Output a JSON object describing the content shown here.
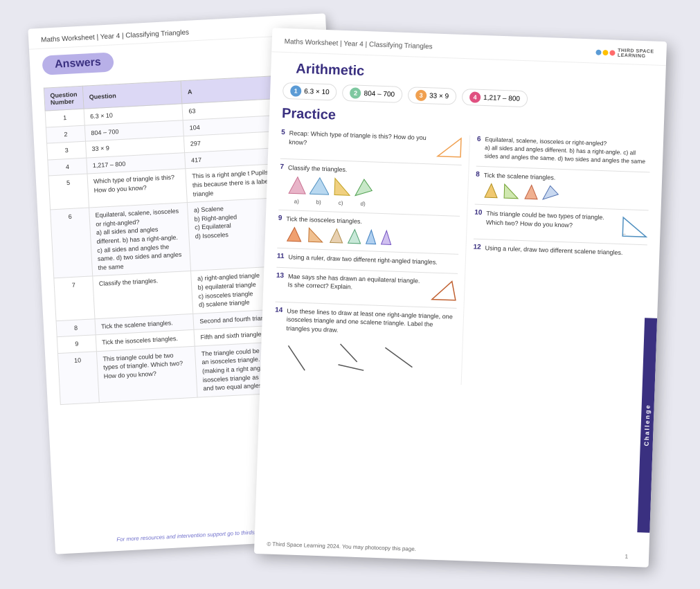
{
  "answers_page": {
    "header": "Maths Worksheet | Year 4 | Classifying Triangles",
    "title": "Answers",
    "footer": "For more resources and intervention support go to thirdspacelearning.c",
    "table": {
      "headers": [
        "Question Number",
        "Question",
        "A"
      ],
      "rows": [
        {
          "num": "1",
          "question": "6.3 × 10",
          "answer": "63"
        },
        {
          "num": "2",
          "question": "804 – 700",
          "answer": "104"
        },
        {
          "num": "3",
          "question": "33 × 9",
          "answer": "297"
        },
        {
          "num": "4",
          "question": "1,217 – 800",
          "answer": "417"
        },
        {
          "num": "5",
          "question": "Which type of triangle is this? How do you know?",
          "answer": "This is a right angle t Pupils should be able this because there is a labelled in the triangle"
        },
        {
          "num": "6",
          "question": "Equilateral, scalene, isosceles or right-angled?\na) all sides and angles different. b) has a right-angle. c) all sides and angles the same. d) two sides and angles the same",
          "answer": "a) Scalene\nb) Right-angled\nc) Equilateral\nd) Isosceles"
        },
        {
          "num": "7",
          "question": "Classify the triangles.",
          "answer": "a) right-angled triangle\nb) equilateral triangle\nc) isosceles triangle\nd) scalene triangle"
        },
        {
          "num": "8",
          "question": "Tick the scalene triangles.",
          "answer": "Second and fourth triangles tic"
        },
        {
          "num": "9",
          "question": "Tick the isosceles triangles.",
          "answer": "Fifth and sixth triangles ticked."
        },
        {
          "num": "10",
          "question": "This triangle could be two types of triangle. Which two? How do you know?",
          "answer": "The triangle could be a right ang triangle or an isosceles triangle. It has a right angle (making it a right angle triangle) but also an isosceles triangle as it has two equal sides and two equal angles."
        }
      ]
    }
  },
  "worksheet_page": {
    "header": "Maths Worksheet | Year 4 | Classifying Triangles",
    "logo_text": "THIRD SPACE\nLEARNING",
    "arithmetic_title": "Arithmetic",
    "arithmetic_items": [
      {
        "num": "1",
        "expr": "6.3 × 10",
        "num_class": "num1"
      },
      {
        "num": "2",
        "expr": "804 – 700",
        "num_class": "num2"
      },
      {
        "num": "3",
        "expr": "33 × 9",
        "num_class": "num3"
      },
      {
        "num": "4",
        "expr": "1,217 – 800",
        "num_class": "num4"
      }
    ],
    "practice_title": "Practice",
    "questions": [
      {
        "num": "5",
        "text": "Recap: Which type of triangle is this? How do you know?"
      },
      {
        "num": "6",
        "text": "Equilateral, scalene, isosceles or right-angled?\na) all sides and angles different. b) has a right-angle. c) all sides and angles the same. d) two sides and angles the same"
      },
      {
        "num": "7",
        "text": "Classify the triangles."
      },
      {
        "num": "8",
        "text": "Tick the scalene triangles."
      },
      {
        "num": "9",
        "text": "Tick the isosceles triangles."
      },
      {
        "num": "10",
        "text": "This triangle could be two types of triangle. Which two? How do you know?"
      },
      {
        "num": "11",
        "text": "Using a ruler, draw two different right-angled triangles."
      },
      {
        "num": "12",
        "text": "Using a ruler, draw two different scalene triangles."
      },
      {
        "num": "13",
        "text": "Mae says she has drawn an equilateral triangle.\nIs she correct? Explain."
      },
      {
        "num": "14",
        "text": "Use these lines to draw at least one right-angle triangle, one isosceles triangle and one scalene triangle. Label the triangles you draw."
      }
    ],
    "challenge_label": "Challenge",
    "footer_copyright": "© Third Space Learning 2024. You may photocopy this page.",
    "page_num": "1"
  }
}
